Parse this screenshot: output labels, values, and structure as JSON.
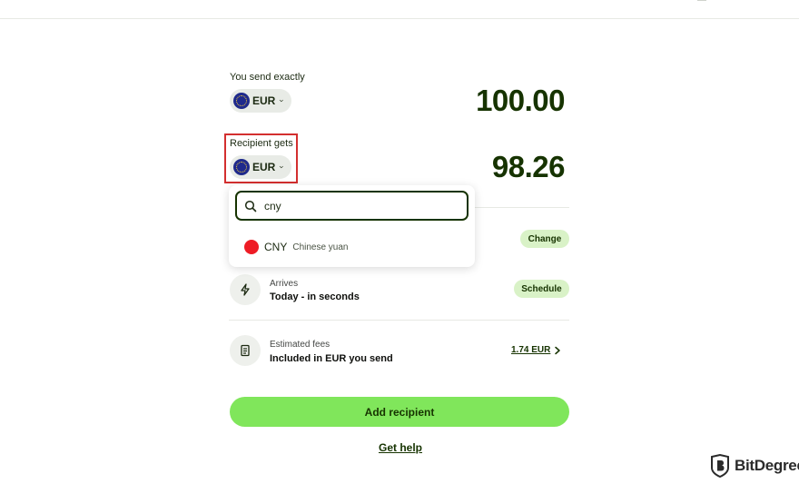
{
  "send": {
    "label": "You send exactly",
    "currency": "EUR",
    "amount": "100.00"
  },
  "receive": {
    "label": "Recipient gets",
    "currency": "EUR",
    "amount": "98.26"
  },
  "dropdown": {
    "search_value": "cny",
    "options": [
      {
        "code": "CNY",
        "name": "Chinese yuan"
      }
    ]
  },
  "rows": {
    "change_chip": "Change",
    "arrives_label": "Arrives",
    "arrives_value": "Today - in seconds",
    "schedule_chip": "Schedule",
    "fees_label": "Estimated fees",
    "fees_value": "Included in EUR you send",
    "fees_amount": "1.74 EUR"
  },
  "actions": {
    "primary": "Add recipient",
    "help": "Get help"
  },
  "watermark": {
    "text": "BitDegree"
  },
  "colors": {
    "brand_dark": "#163300",
    "brand_green": "#80e65b",
    "chip_bg": "#d9f2c7",
    "highlight": "#d32f2f"
  }
}
